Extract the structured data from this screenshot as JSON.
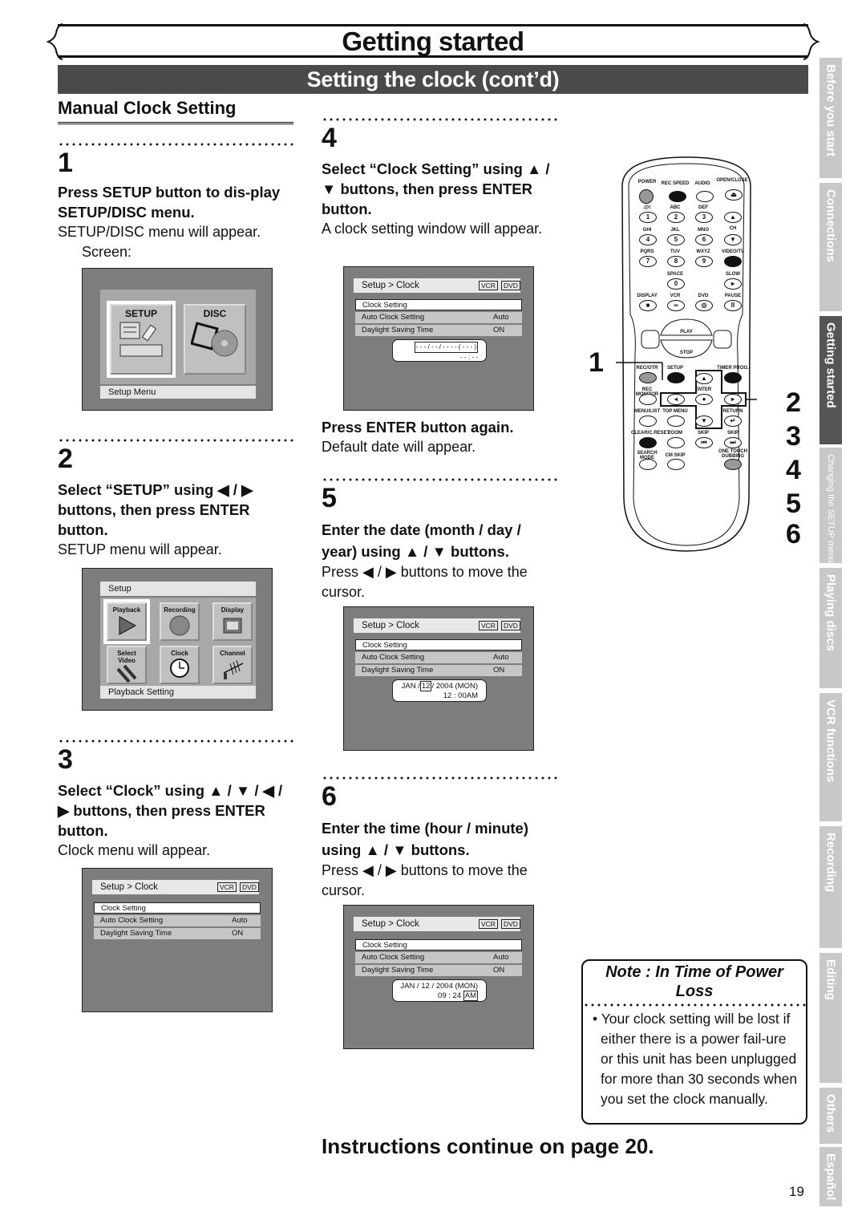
{
  "header": {
    "title": "Getting started",
    "section": "Setting the clock (cont’d)"
  },
  "side_tabs": [
    {
      "label": "Before you start",
      "active": false
    },
    {
      "label": "Connections",
      "active": false
    },
    {
      "label": "Getting started",
      "active": true
    },
    {
      "label": "Changing the SETUP menu",
      "active": false
    },
    {
      "label": "Playing discs",
      "active": false
    },
    {
      "label": "VCR functions",
      "active": false
    },
    {
      "label": "Recording",
      "active": false
    },
    {
      "label": "Editing",
      "active": false
    },
    {
      "label": "Others",
      "active": false
    },
    {
      "label": "Español",
      "active": false
    }
  ],
  "subheading": "Manual Clock Setting",
  "steps": [
    {
      "num": "1",
      "instruction": "Press SETUP button to dis-play SETUP/DISC menu.",
      "description": "SETUP/DISC menu will appear.",
      "extra": "Screen:"
    },
    {
      "num": "2",
      "instruction": "Select “SETUP” using ◀ / ▶ buttons, then press ENTER button.",
      "description": "SETUP menu will appear."
    },
    {
      "num": "3",
      "instruction": "Select “Clock” using ▲ / ▼ / ◀ / ▶ buttons, then press ENTER button.",
      "description": "Clock menu will appear."
    },
    {
      "num": "4",
      "instruction": "Select “Clock Setting” using ▲ / ▼ buttons, then press ENTER button.",
      "description": "A clock setting window will appear.",
      "instruction2": "Press ENTER button again.",
      "description2": "Default date will appear."
    },
    {
      "num": "5",
      "instruction": "Enter the date (month / day / year) using ▲ / ▼ buttons.",
      "description": "Press ◀ / ▶ buttons to move the cursor."
    },
    {
      "num": "6",
      "instruction": "Enter the time (hour / minute) using ▲ / ▼ buttons.",
      "description": "Press ◀ / ▶ buttons to move the cursor."
    }
  ],
  "screen_setup_disc": {
    "tiles": [
      "SETUP",
      "DISC"
    ],
    "footer": "Setup Menu"
  },
  "screen_setup": {
    "header": "Setup",
    "tiles": [
      "Playback",
      "Recording",
      "Display",
      "Select Video",
      "Clock",
      "Channel"
    ],
    "footer": "Playback Setting"
  },
  "clock_menu": {
    "breadcrumb": "Setup > Clock",
    "tags": [
      "VCR",
      "DVD"
    ],
    "rows": [
      {
        "label": "Clock Setting",
        "value": ""
      },
      {
        "label": "Auto Clock Setting",
        "value": "Auto"
      },
      {
        "label": "Daylight Saving Time",
        "value": "ON"
      }
    ]
  },
  "clock_windows": {
    "blank": {
      "date": "- - - / - - / - - - - ( - - - )",
      "time": "- - : - -"
    },
    "default": {
      "month": "JAN /",
      "day": "12",
      "rest": "/ 2004 (MON)",
      "time": "12 : 00AM"
    },
    "set": {
      "date": "JAN / 12 / 2004 (MON)",
      "time_main": "09 : 24",
      "ampm": "AM"
    }
  },
  "remote": {
    "top_labels": [
      "POWER",
      "REC SPEED",
      "AUDIO",
      "OPEN/CLOSE"
    ],
    "numpad": [
      {
        "sub": ".@/:",
        "key": "1"
      },
      {
        "sub": "ABC",
        "key": "2"
      },
      {
        "sub": "DEF",
        "key": "3"
      },
      {
        "sub": "GHI",
        "key": "4"
      },
      {
        "sub": "JKL",
        "key": "5"
      },
      {
        "sub": "MNO",
        "key": "6"
      },
      {
        "sub": "PQRS",
        "key": "7"
      },
      {
        "sub": "TUV",
        "key": "8"
      },
      {
        "sub": "WXYZ",
        "key": "9"
      },
      {
        "sub": "SPACE",
        "key": "0"
      }
    ],
    "ch_label": "CH",
    "video_tv": "VIDEO/TV",
    "slow": "SLOW",
    "row_labels": [
      "DISPLAY",
      "VCR",
      "DVD",
      "PAUSE"
    ],
    "play": "PLAY",
    "stop": "STOP",
    "lower_labels": [
      "REC/OTR",
      "SETUP",
      "TIMER PROG.",
      "REC MONITOR",
      "ENTER",
      "MENU/LIST",
      "TOP MENU",
      "RETURN",
      "CLEAR/C.RESET",
      "ZOOM",
      "SKIP",
      "SKIP",
      "SEARCH MODE",
      "CM SKIP",
      "ONE TOUCH DUBBING"
    ],
    "callouts": [
      "1",
      "2",
      "3",
      "4",
      "5",
      "6"
    ]
  },
  "note": {
    "title": "Note : In Time of Power Loss",
    "body": "Your clock setting will be lost if either there is a power fail-ure or this unit has been unplugged for more than 30 seconds when you set the clock manually."
  },
  "continue_text": "Instructions continue on page 20.",
  "page_number": "19"
}
